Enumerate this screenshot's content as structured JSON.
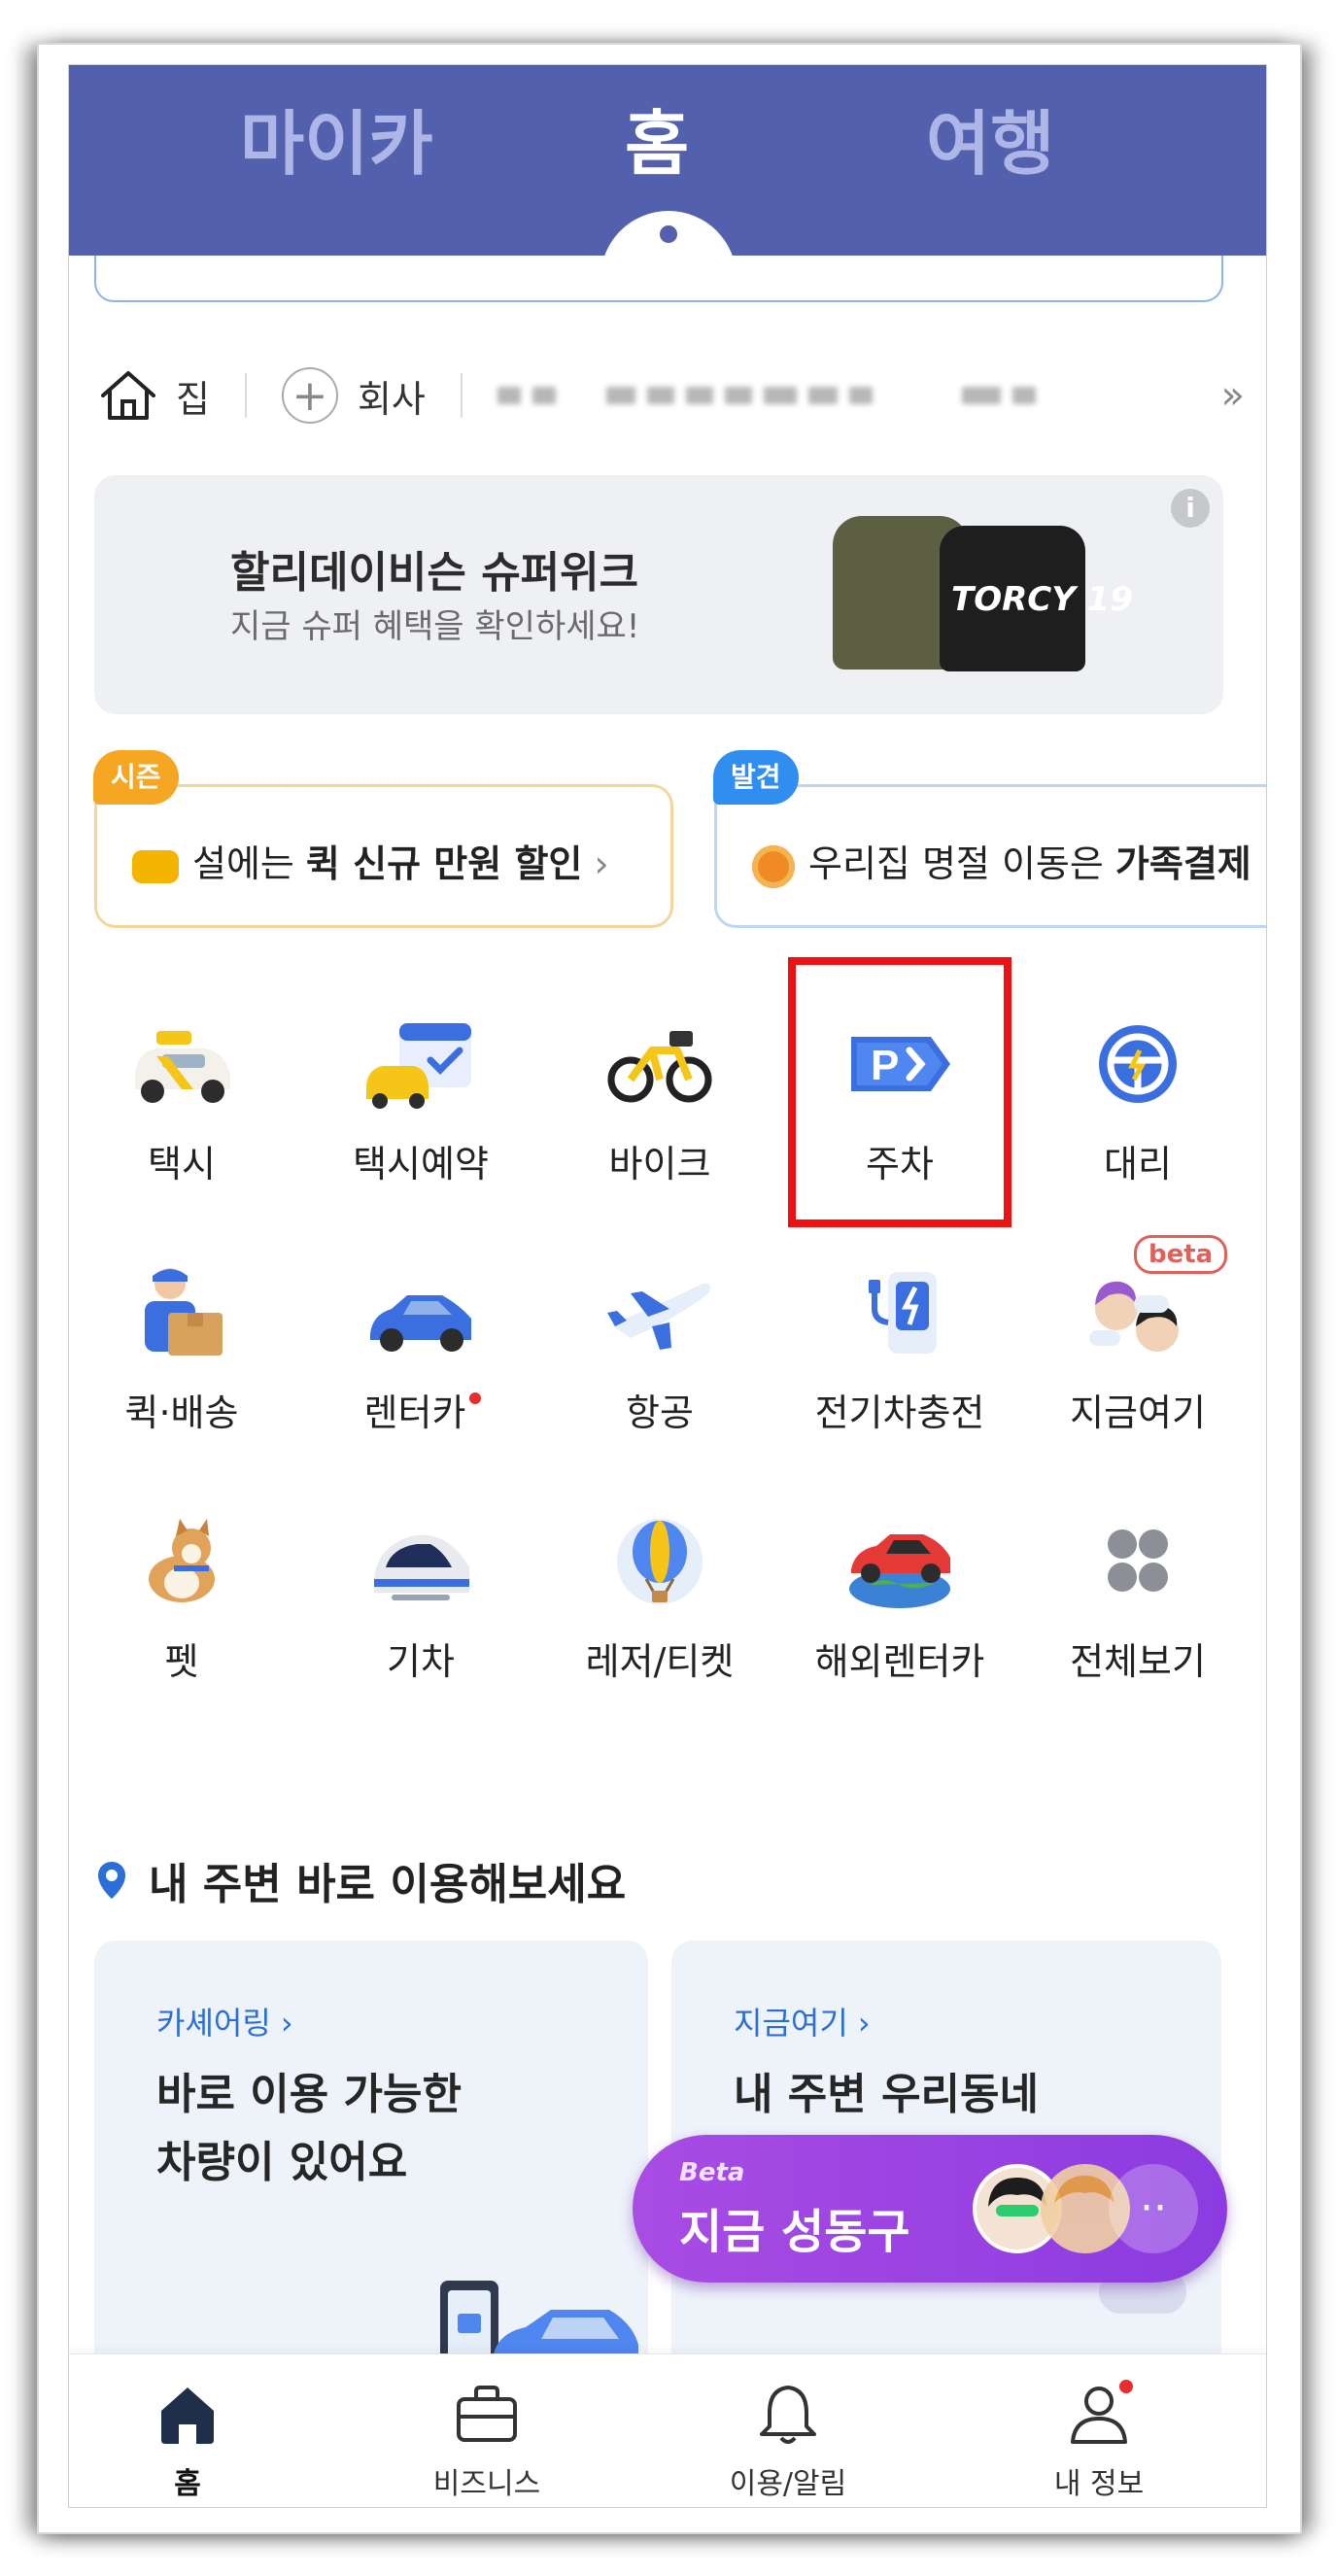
{
  "header": {
    "tabs": [
      {
        "label": "마이카",
        "active": false
      },
      {
        "label": "홈",
        "active": true
      },
      {
        "label": "여행",
        "active": false
      }
    ],
    "color": "#5260ad"
  },
  "shortcuts": {
    "home": "집",
    "work": "회사",
    "more_icon": "double-chevron-right"
  },
  "banner": {
    "title": "할리데이비슨 슈퍼위크",
    "subtitle": "지금 슈퍼 혜택을 확인하세요!",
    "product_text": "TORCY 19"
  },
  "promos": [
    {
      "badge": "시즌",
      "pre": "설에는 ",
      "bold": "퀵 신규 만원 할인",
      "post": " ›"
    },
    {
      "badge": "발견",
      "pre": "우리집 명절 이동은 ",
      "bold": "가족결제",
      "post": ""
    }
  ],
  "services": [
    {
      "label": "택시",
      "icon": "taxi-icon"
    },
    {
      "label": "택시예약",
      "icon": "taxi-reservation-icon"
    },
    {
      "label": "바이크",
      "icon": "bike-icon"
    },
    {
      "label": "주차",
      "icon": "parking-icon"
    },
    {
      "label": "대리",
      "icon": "steering-wheel-icon"
    },
    {
      "label": "퀵·배송",
      "icon": "courier-icon"
    },
    {
      "label": "렌터카",
      "icon": "rental-car-icon"
    },
    {
      "label": "항공",
      "icon": "airplane-icon"
    },
    {
      "label": "전기차충전",
      "icon": "ev-charger-icon"
    },
    {
      "label": "지금여기",
      "icon": "people-chat-icon",
      "badge": "beta"
    },
    {
      "label": "펫",
      "icon": "dog-icon"
    },
    {
      "label": "기차",
      "icon": "train-icon"
    },
    {
      "label": "레저/티켓",
      "icon": "balloon-icon"
    },
    {
      "label": "해외렌터카",
      "icon": "global-car-icon"
    },
    {
      "label": "전체보기",
      "icon": "grid-icon"
    }
  ],
  "nearby": {
    "title": "내 주변 바로 이용해보세요",
    "cards": [
      {
        "link": "카셰어링 ›",
        "headline": "바로 이용 가능한\n차량이 있어요"
      },
      {
        "link": "지금여기 ›",
        "headline": "내 주변 우리동네"
      }
    ]
  },
  "floating": {
    "beta": "Beta",
    "text": "지금 성동구",
    "more": "··"
  },
  "bottom_nav": [
    {
      "label": "홈",
      "icon": "home-icon",
      "active": true
    },
    {
      "label": "비즈니스",
      "icon": "briefcase-icon",
      "active": false
    },
    {
      "label": "이용/알림",
      "icon": "bell-icon",
      "active": false
    },
    {
      "label": "내 정보",
      "icon": "person-icon",
      "active": false
    }
  ]
}
